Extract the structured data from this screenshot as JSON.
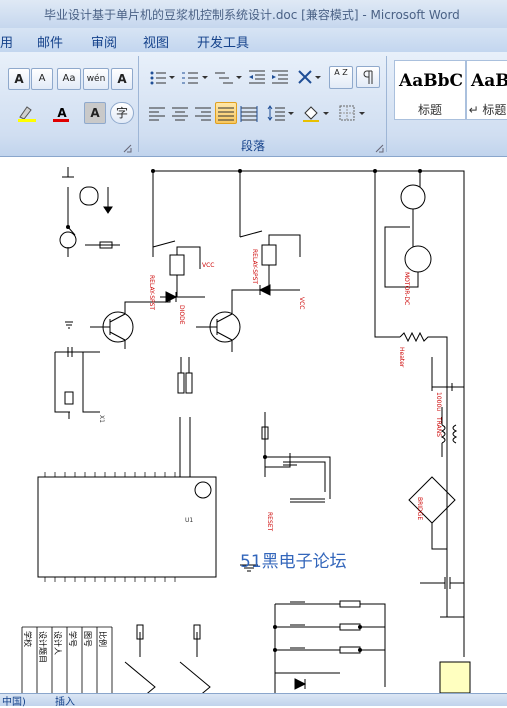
{
  "window": {
    "title": "毕业设计基于单片机的豆浆机控制系统设计.doc [兼容模式] - Microsoft Word"
  },
  "menu": {
    "items": [
      "用",
      "邮件",
      "审阅",
      "视图",
      "开发工具"
    ]
  },
  "ribbon": {
    "font_group": {
      "grow_font": "A",
      "shrink_font": "A",
      "clear_format": "Aa",
      "phonetic": "wén",
      "char_border": "A",
      "font_color": "A",
      "char_shading": "A",
      "enclose_char": "字"
    },
    "paragraph_group": {
      "label": "段落",
      "sort": "A Z"
    },
    "styles": [
      {
        "sample": "AaBbC",
        "name": "标题"
      },
      {
        "sample": "AaB",
        "name": "↵ 标题"
      }
    ]
  },
  "document": {
    "watermark": "51黑电子论坛",
    "labels": {
      "u1": "U1",
      "relay1": "RELAY-SPST",
      "relay2": "RELAY-SPST",
      "motor": "MOTOR-DC",
      "heater": "Heater",
      "trans": "TRANS",
      "bridge": "BRIDGE",
      "vcc1": "VCC",
      "vcc2": "VCC",
      "d1": "D1",
      "d2": "D2",
      "diode": "DIODE",
      "reset": "RESET",
      "cap": "1000u",
      "x1": "X1"
    },
    "title_block": [
      "学校",
      "设计题目",
      "设计人",
      "学号",
      "图号",
      "比例"
    ]
  },
  "status": {
    "left": "中国)",
    "insert": "插入"
  }
}
